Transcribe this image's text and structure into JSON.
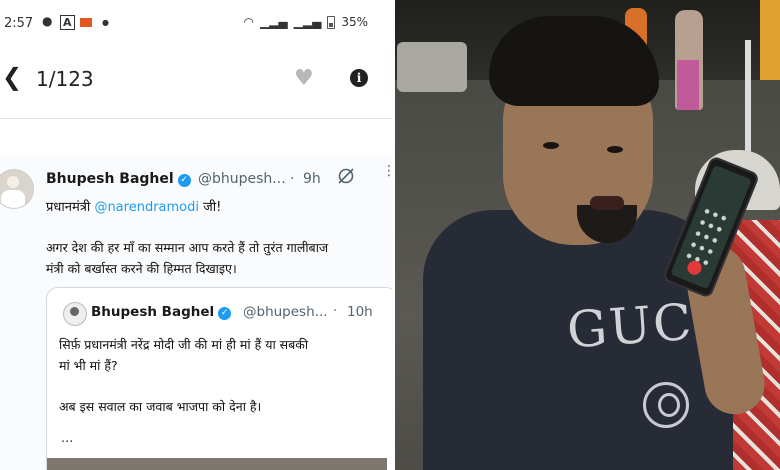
{
  "status_bar": {
    "time": "2:57",
    "battery": "35%",
    "notification_icons": [
      "chat-icon",
      "a-app-icon",
      "orange-app-icon",
      "dot-icon"
    ],
    "signal_icons": [
      "wifi-icon",
      "signal-1-icon",
      "signal-2-icon",
      "battery-icon"
    ]
  },
  "app_bar": {
    "counter": "1/123",
    "back_icon": "back-chevron-icon",
    "like_icon": "heart-icon",
    "info_icon": "info-icon"
  },
  "tweet": {
    "author": "Bhupesh Baghel",
    "handle": "@bhupesh...",
    "separator": "·",
    "age": "9h",
    "more": "⋮",
    "line1_prefix": "प्रधानमंत्री ",
    "mention": "@narendramodi",
    "line1_suffix": " जी!",
    "body_line1": "अगर देश की हर माँ का सम्मान आप करते हैं तो तुरंत गालीबाज",
    "body_line2": "मंत्री को बर्खास्त करने की हिम्मत दिखाइए।",
    "quoted": {
      "author": "Bhupesh Baghel",
      "handle": "@bhupesh...",
      "separator": "·",
      "age": "10h",
      "line1": "सिर्फ़ प्रधानमंत्री नरेंद्र मोदी जी की मां ही मां हैं या सबकी",
      "line2": "मां भी मां हैं?",
      "line3": "अब इस सवाल का जवाब भाजपा को देना है।",
      "ellipsis": "..."
    }
  },
  "photo": {
    "shirt_logo": "GUCCI",
    "accent_color": "#1d9bf0"
  }
}
